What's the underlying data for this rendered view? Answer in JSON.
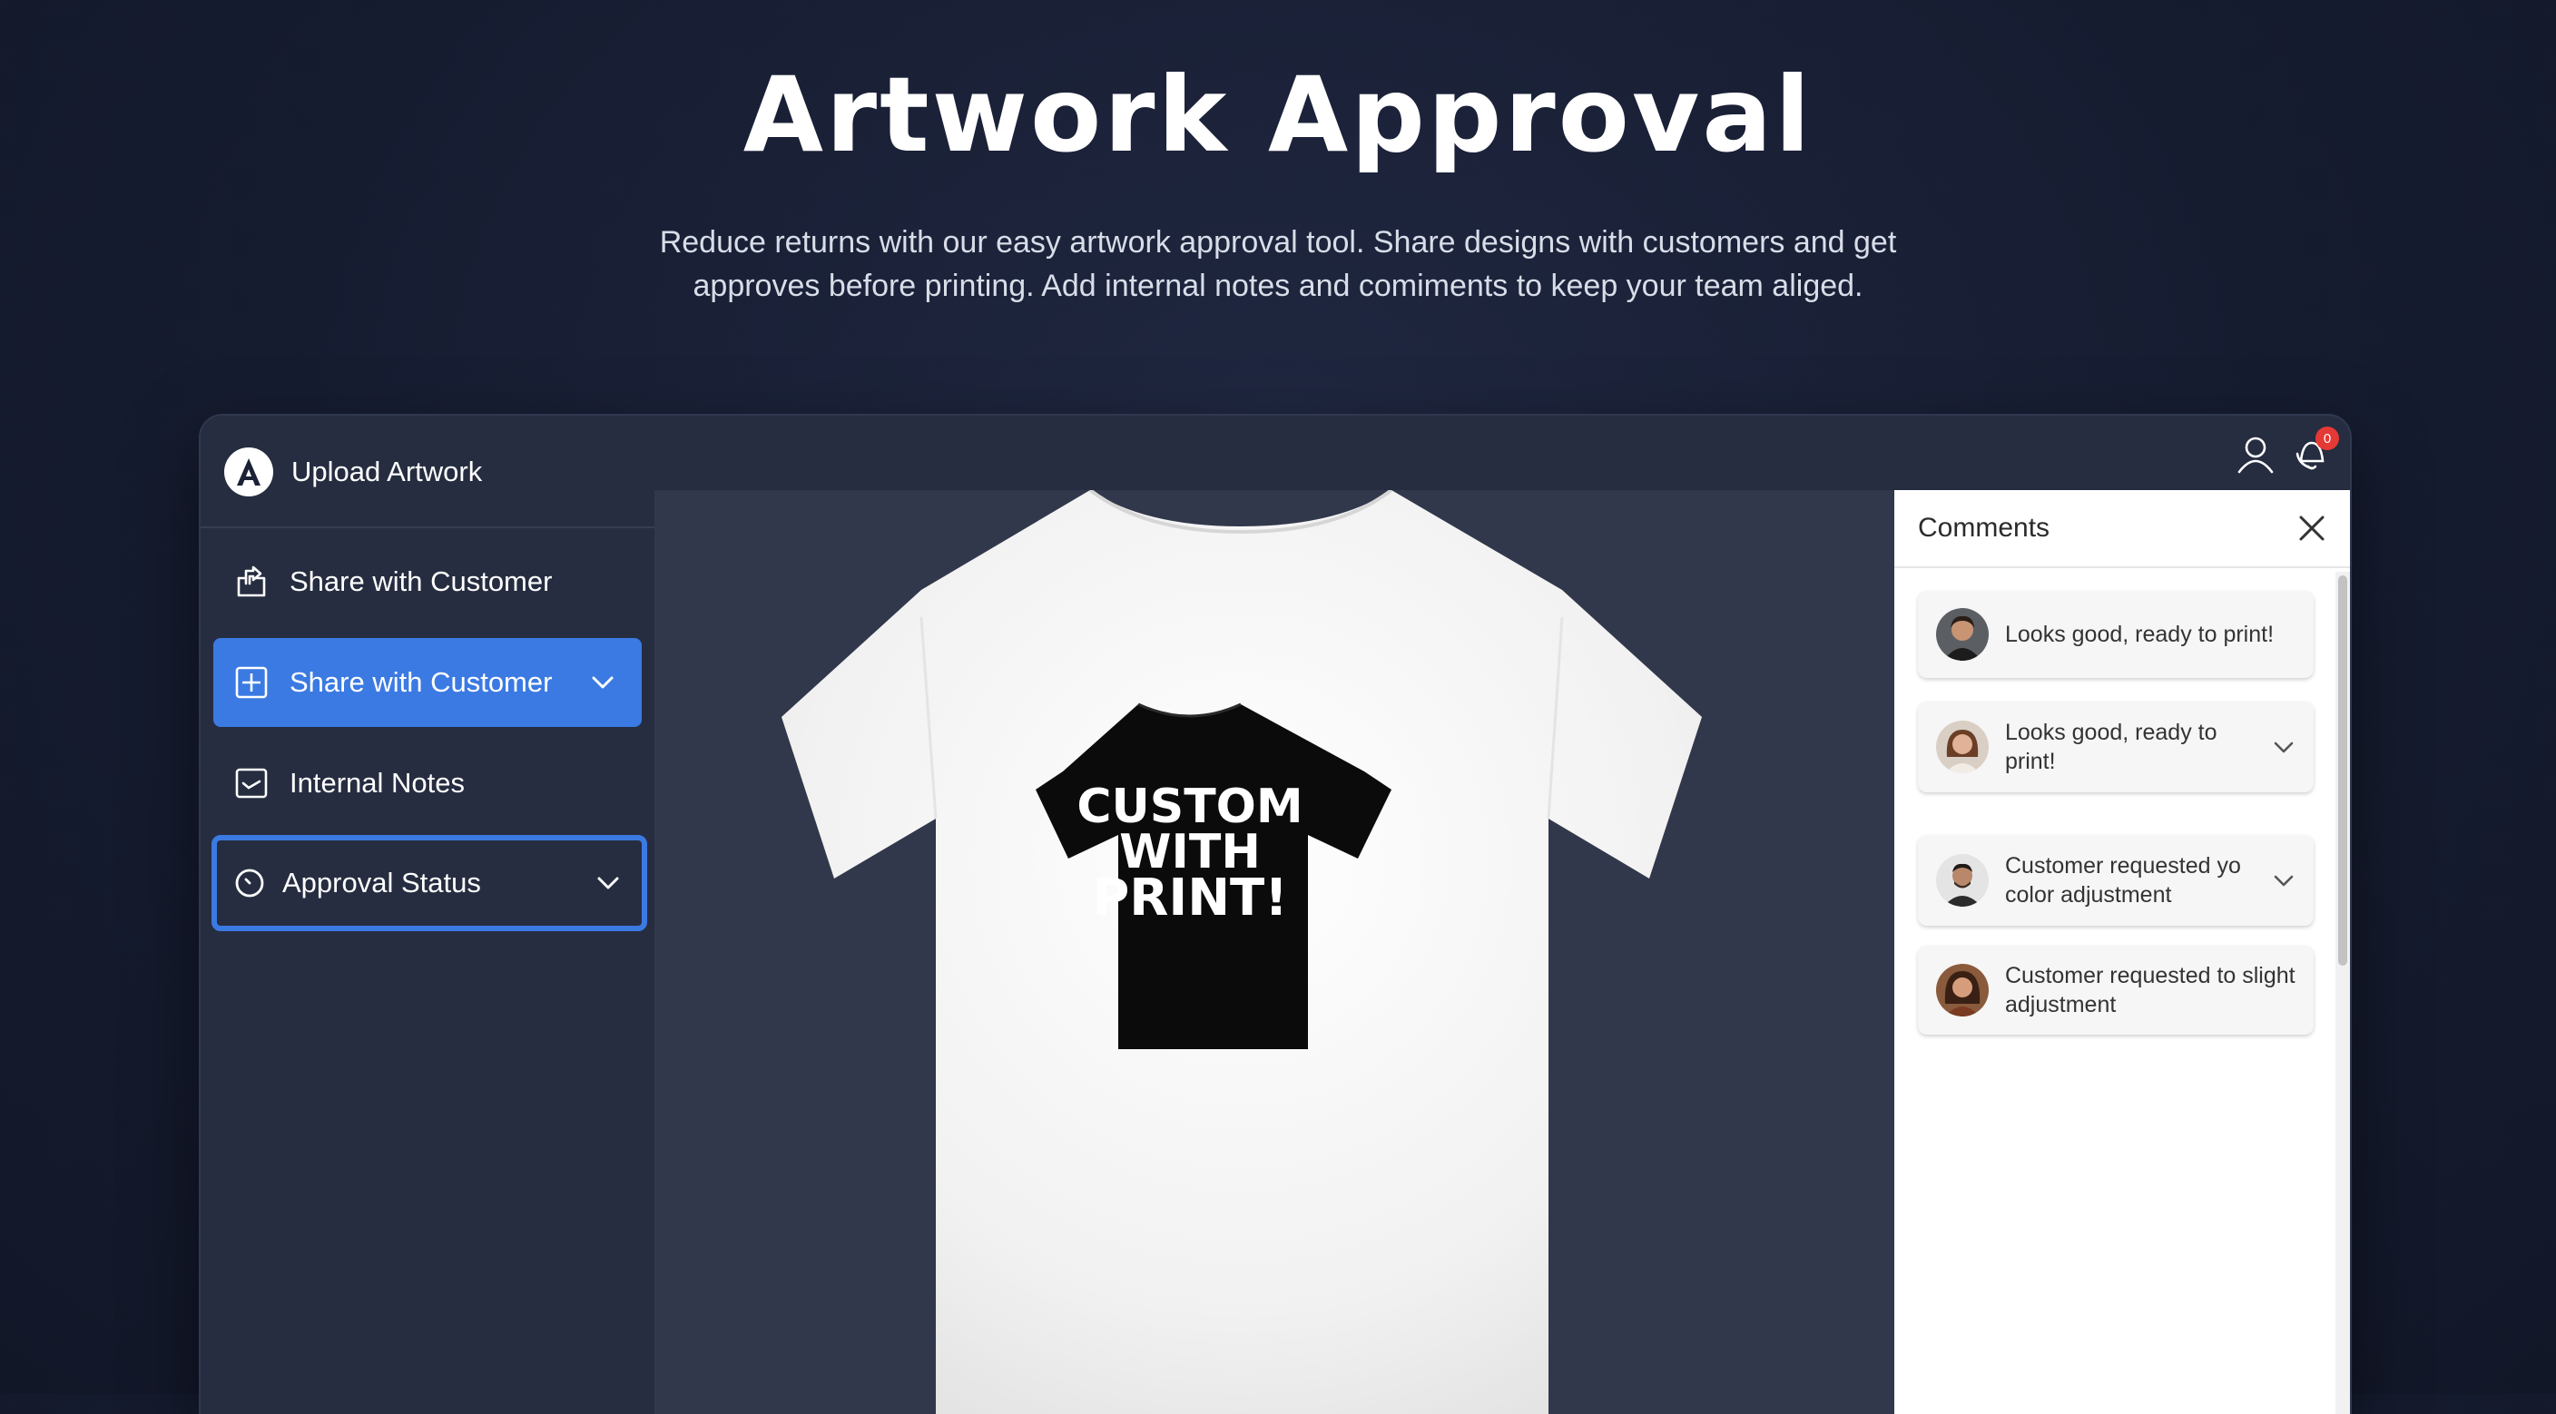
{
  "hero": {
    "title": "Artwork Approval",
    "subtitle_line1": "Reduce returns with our easy artwork approval tool. Share designs with customers and get",
    "subtitle_line2": "approves before printing. Add internal notes and comiments to keep your team aliged."
  },
  "sidebar": {
    "brand_letter": "A",
    "brand_label": "Upload Artwork",
    "items": [
      {
        "label": "Share with Customer",
        "icon": "share-upload-icon"
      },
      {
        "label": "Share with Customer",
        "icon": "plus-square-icon",
        "active": true
      },
      {
        "label": "Internal Notes",
        "icon": "notes-icon"
      },
      {
        "label": "Approval Status",
        "icon": "clock-icon",
        "focused": true
      }
    ]
  },
  "header_icons": {
    "user_icon": "user-icon",
    "notification_icon": "bell-icon",
    "notification_count": "0"
  },
  "artwork": {
    "print_line1": "CUSTOM",
    "print_line2": "WITH",
    "print_line3": "PRINT!"
  },
  "comments": {
    "title": "Comments",
    "items": [
      {
        "text": "Looks good, ready to print!",
        "expandable": false
      },
      {
        "text": "Looks good, ready to print!",
        "expandable": true
      },
      {
        "text": "Customer requested yo color adjustment",
        "expandable": true
      },
      {
        "text": "Customer requested to slight adjustment",
        "expandable": false
      }
    ]
  },
  "colors": {
    "background": "#161c30",
    "panel": "#262d40",
    "canvas": "#32384b",
    "accent": "#3b7ae2",
    "badge": "#e53935"
  }
}
